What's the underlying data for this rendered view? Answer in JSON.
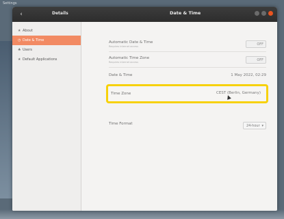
{
  "app": {
    "label": "Settings"
  },
  "headerbar": {
    "left_title": "Details",
    "title": "Date & Time"
  },
  "sidebar": {
    "items": [
      {
        "icon": "info-icon",
        "glyph": "★",
        "label": "About",
        "selected": false
      },
      {
        "icon": "clock-icon",
        "glyph": "◷",
        "label": "Date & Time",
        "selected": true
      },
      {
        "icon": "users-icon",
        "glyph": "♣",
        "label": "Users",
        "selected": false
      },
      {
        "icon": "star-icon",
        "glyph": "★",
        "label": "Default Applications",
        "selected": false
      }
    ]
  },
  "settings": {
    "auto_date_time": {
      "label": "Automatic Date & Time",
      "sub": "Requires internet access",
      "value": "OFF"
    },
    "auto_time_zone": {
      "label": "Automatic Time Zone",
      "sub": "Requires internet access",
      "value": "OFF"
    },
    "date_time": {
      "label": "Date & Time",
      "value": "1 May 2022, 02:29"
    },
    "time_zone": {
      "label": "Time Zone",
      "value": "CEST (Berlin, Germany)"
    },
    "time_format": {
      "label": "Time Format",
      "value": "24-hour"
    }
  },
  "colors": {
    "accent": "#f28a63",
    "highlight": "#f7d10a",
    "headerbar": "#2d2d2d"
  }
}
